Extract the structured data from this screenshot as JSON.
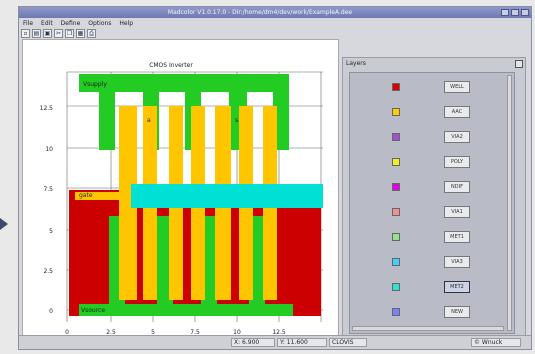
{
  "window": {
    "title": "Madcolor V1.0.17.0 - Dir:/home/dm4/dev/work/ExampleA.dee",
    "menu": [
      "File",
      "Edit",
      "Define",
      "Options",
      "Help"
    ],
    "toolbar_icons": [
      "new-icon",
      "open-icon",
      "save-icon",
      "cut-icon",
      "copy-icon",
      "paste-icon",
      "print-icon"
    ]
  },
  "canvas": {
    "title": "CMOS Inverter",
    "labels": {
      "vsupply": "Vsupply",
      "a": "a",
      "s": "s",
      "gate": "gate",
      "vsource": "Vsource"
    },
    "y_ticks": [
      "12.5",
      "10",
      "7.5",
      "5",
      "2.5",
      "0"
    ],
    "x_ticks": [
      "0",
      "2.5",
      "5",
      "7.5",
      "10",
      "12.5"
    ]
  },
  "layers": {
    "title": "Layers",
    "items": [
      {
        "label": "WELL",
        "color": "#d90000",
        "selected": false
      },
      {
        "label": "AAC",
        "color": "#ffd000",
        "selected": false
      },
      {
        "label": "VIA2",
        "color": "#a050d0",
        "selected": false
      },
      {
        "label": "POLY",
        "color": "#f2f020",
        "selected": false
      },
      {
        "label": "NDIF",
        "color": "#e000e0",
        "selected": false
      },
      {
        "label": "VIA1",
        "color": "#f29090",
        "selected": false
      },
      {
        "label": "MET1",
        "color": "#9ae08a",
        "selected": false
      },
      {
        "label": "VIA3",
        "color": "#3fd0ff",
        "selected": false
      },
      {
        "label": "MET2",
        "color": "#30e0d0",
        "selected": true
      },
      {
        "label": "NEW",
        "color": "#7a80ff",
        "selected": false
      }
    ]
  },
  "status": {
    "x": "X: 6.900",
    "y": "Y: 11.600",
    "mode": "CLOVIS",
    "credit": "© Wnuck"
  }
}
